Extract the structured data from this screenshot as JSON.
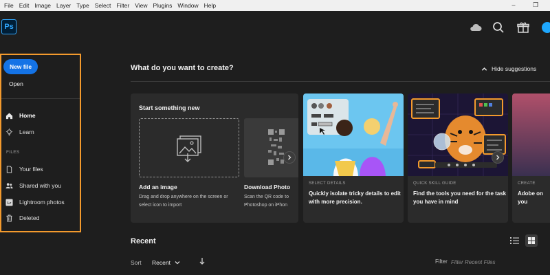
{
  "menu": [
    "File",
    "Edit",
    "Image",
    "Layer",
    "Type",
    "Select",
    "Filter",
    "View",
    "Plugins",
    "Window",
    "Help"
  ],
  "window_controls": {
    "minimize": "–",
    "restore": "❐"
  },
  "app": {
    "logo": "Ps"
  },
  "header_icons": [
    "cloud-icon",
    "search-icon",
    "gift-icon",
    "avatar"
  ],
  "sidebar": {
    "new_file": "New file",
    "open": "Open",
    "nav": [
      {
        "label": "Home",
        "icon": "home-icon",
        "active": true
      },
      {
        "label": "Learn",
        "icon": "lightbulb-icon"
      }
    ],
    "files_label": "FILES",
    "files": [
      {
        "label": "Your files",
        "icon": "file-icon"
      },
      {
        "label": "Shared with you",
        "icon": "people-icon"
      },
      {
        "label": "Lightroom photos",
        "icon": "lightroom-icon"
      },
      {
        "label": "Deleted",
        "icon": "trash-icon"
      }
    ]
  },
  "main": {
    "title": "What do you want to create?",
    "hide_suggestions": "Hide suggestions",
    "start": {
      "title": "Start something new",
      "add_image": {
        "title": "Add an image",
        "desc_line1": "Drag and drop anywhere on the screen or",
        "desc_line2": "select icon to import"
      },
      "download_photo": {
        "title": "Download Photo",
        "desc_line1": "Scan the QR code to",
        "desc_line2": "Photoshop on iPhon"
      }
    },
    "suggestions": [
      {
        "kicker": "SELECT DETAILS",
        "desc": "Quickly isolate tricky details to edit with more precision."
      },
      {
        "kicker": "QUICK SKILL GUIDE",
        "desc": "Find the tools you need for the task you have in mind"
      },
      {
        "kicker": "CREATE",
        "desc": "Adobe on you"
      }
    ],
    "recent": {
      "title": "Recent",
      "sort_label": "Sort",
      "sort_value": "Recent",
      "filter_label": "Filter",
      "filter_placeholder": "Filter Recent Files"
    }
  },
  "colors": {
    "accent": "#1473e6",
    "highlight": "#f39a2d",
    "background": "#1e1e1e",
    "card": "#2b2b2b"
  }
}
